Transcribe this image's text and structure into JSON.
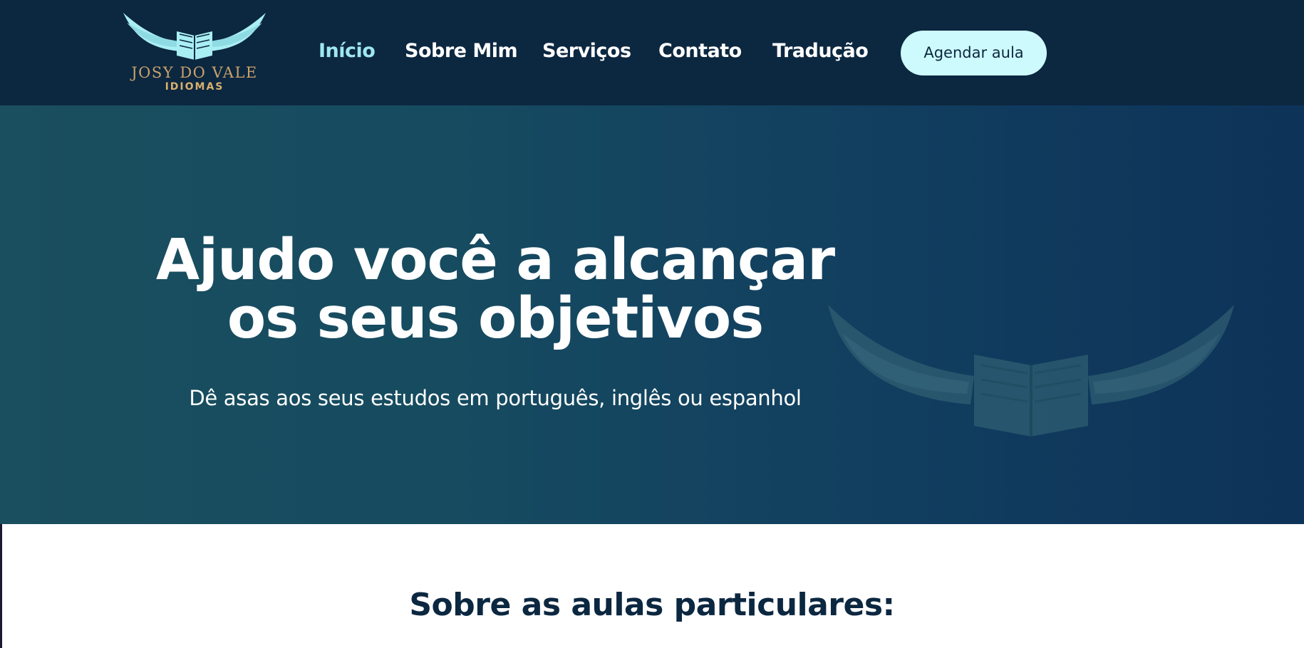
{
  "header": {
    "logo": {
      "name": "JOSY DO VALE",
      "subtitle": "IDIOMAS",
      "icon": "winged-book-icon"
    },
    "nav": [
      {
        "label": "Início",
        "active": true
      },
      {
        "label": "Sobre Mim",
        "active": false
      },
      {
        "label": "Serviços",
        "active": false
      },
      {
        "label": "Contato",
        "active": false
      },
      {
        "label": "Tradução",
        "active": false
      }
    ],
    "cta_label": "Agendar aula"
  },
  "hero": {
    "title_line1": "Ajudo você a alcançar",
    "title_line2": "os seus objetivos",
    "subtitle": "Dê asas aos seus estudos em português, inglês ou espanhol",
    "background_icon": "winged-book-icon"
  },
  "section": {
    "title": "Sobre as aulas particulares:"
  },
  "colors": {
    "header_bg": "#0c2740",
    "accent": "#9fe7ef",
    "cta_bg": "#cdfbfd",
    "logo_gold": "#c9a26a",
    "hero_gradient_start": "#1a4f5f",
    "hero_gradient_end": "#0d3358",
    "section_title": "#0c2740"
  }
}
